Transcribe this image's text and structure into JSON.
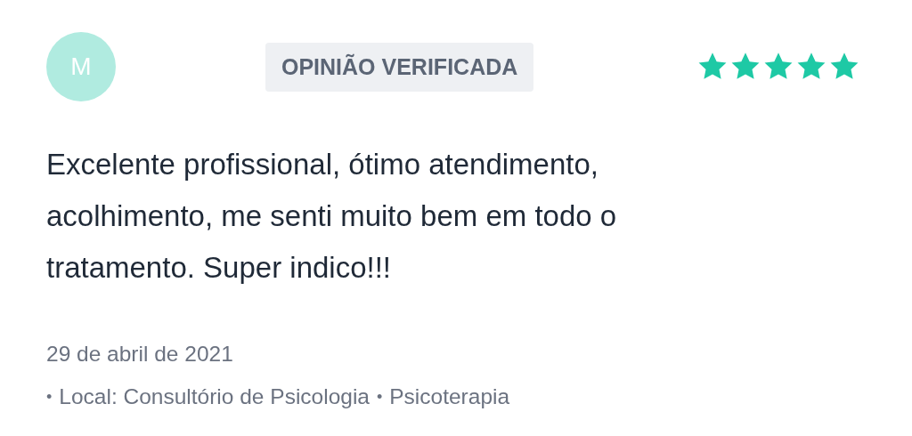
{
  "review": {
    "avatar_initial": "M",
    "badge": "OPINIÃO VERIFICADA",
    "stars": 5,
    "text": "Excelente profissional, ótimo atendimento, acolhimento, me senti muito bem em todo o tratamento. Super indico!!!",
    "date": "29 de abril de 2021",
    "details": [
      "Local: Consultório de Psicologia",
      "Psicoterapia"
    ],
    "separator": "•"
  }
}
